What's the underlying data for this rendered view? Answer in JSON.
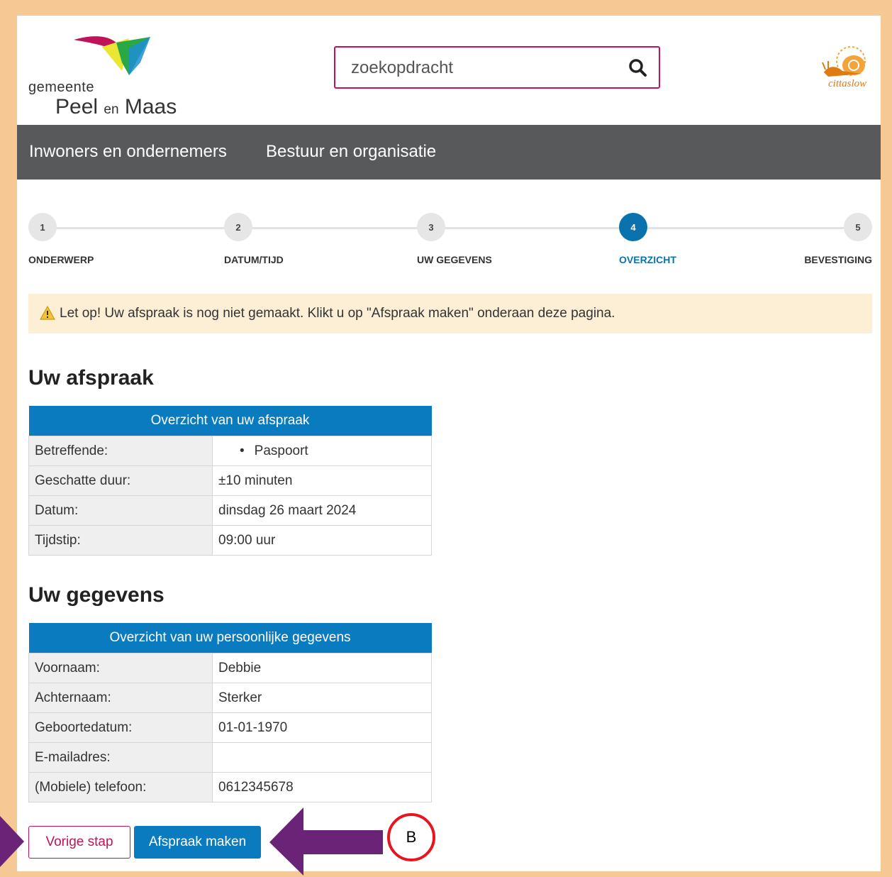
{
  "header": {
    "logo": {
      "small": "gemeente",
      "big_1": "Peel",
      "big_en": "en",
      "big_2": "Maas"
    },
    "search": {
      "placeholder": "zoekopdracht"
    },
    "partner_logo": {
      "text": "cittaslow"
    }
  },
  "nav": {
    "items": [
      {
        "label": "Inwoners en ondernemers"
      },
      {
        "label": "Bestuur en organisatie"
      }
    ]
  },
  "stepper": {
    "current_step": 4,
    "steps": [
      {
        "number": "1",
        "label": "ONDERWERP"
      },
      {
        "number": "2",
        "label": "DATUM/TIJD"
      },
      {
        "number": "3",
        "label": "UW GEGEVENS"
      },
      {
        "number": "4",
        "label": "OVERZICHT"
      },
      {
        "number": "5",
        "label": "BEVESTIGING"
      }
    ]
  },
  "notice": {
    "text": "Let op! Uw afspraak is nog niet gemaakt. Klikt u op \"Afspraak maken\" onderaan deze pagina.",
    "accent": "#fdefd6"
  },
  "appointment": {
    "heading": "Uw afspraak",
    "table_title": "Overzicht van uw afspraak",
    "rows": [
      {
        "key": "Betreffende:",
        "value": "Paspoort"
      },
      {
        "key": "Geschatte duur:",
        "value": "±10 minuten"
      },
      {
        "key": "Datum:",
        "value": "dinsdag 26 maart 2024"
      },
      {
        "key": "Tijdstip:",
        "value": "09:00 uur"
      }
    ]
  },
  "personal": {
    "heading": "Uw gegevens",
    "table_title": "Overzicht van uw persoonlijke gegevens",
    "rows": [
      {
        "key": "Voornaam:",
        "value": "Debbie"
      },
      {
        "key": "Achternaam:",
        "value": "Sterker"
      },
      {
        "key": "Geboortedatum:",
        "value": "01-01-1970"
      },
      {
        "key": "E-mailadres:",
        "value": ""
      },
      {
        "key": "(Mobiele) telefoon:",
        "value": "0612345678"
      }
    ]
  },
  "buttons": {
    "previous": "Vorige stap",
    "submit": "Afspraak maken"
  },
  "annotation": {
    "marker_label": "B",
    "arrow_color": "#6b2378",
    "marker_color": "#e8141e"
  },
  "colors": {
    "brand_blue": "#0a7bbf",
    "brand_magenta": "#c0145a",
    "nav_bg": "#58595b",
    "frame": "#f5c894"
  }
}
